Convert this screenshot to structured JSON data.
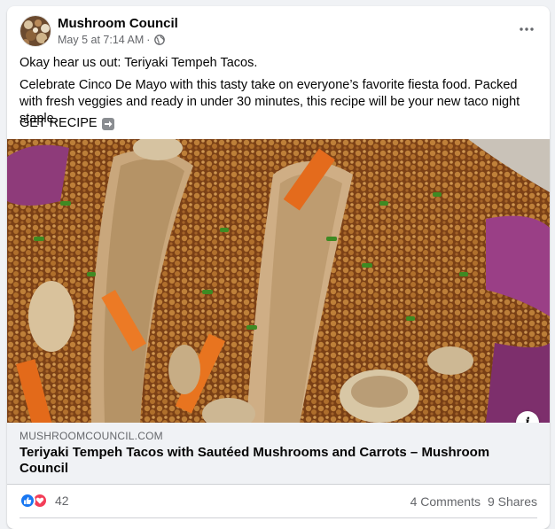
{
  "post": {
    "author": "Mushroom Council",
    "timestamp": "May 5 at 7:14 AM",
    "separator": "·",
    "privacy_icon": "globe-icon",
    "more_icon": "more-options-icon",
    "text_line1": "Okay hear us out: Teriyaki Tempeh Tacos.",
    "text_paragraph": "Celebrate Cinco De Mayo with this tasty take on everyone’s favorite fiesta food. Packed with fresh veggies and ready in under 30 minutes, this recipe will be your new taco night staple.",
    "cta_text": "GET RECIPE",
    "cta_icon": "right-arrow-emoji-icon"
  },
  "link_preview": {
    "domain": "MUSHROOMCOUNCIL.COM",
    "title": "Teriyaki Tempeh Tacos with Sautéed Mushrooms and Carrots – Mushroom Council",
    "info_icon": "info-icon",
    "info_glyph": "i"
  },
  "engagement": {
    "reaction_count": "42",
    "reaction_icons": [
      "like-icon",
      "love-icon"
    ],
    "comments": "4 Comments",
    "shares": "9 Shares"
  },
  "colors": {
    "background": "#f0f2f5",
    "card": "#ffffff",
    "secondary_text": "#65676b",
    "like_blue": "#1877f2",
    "love_red": "#f33e58"
  }
}
